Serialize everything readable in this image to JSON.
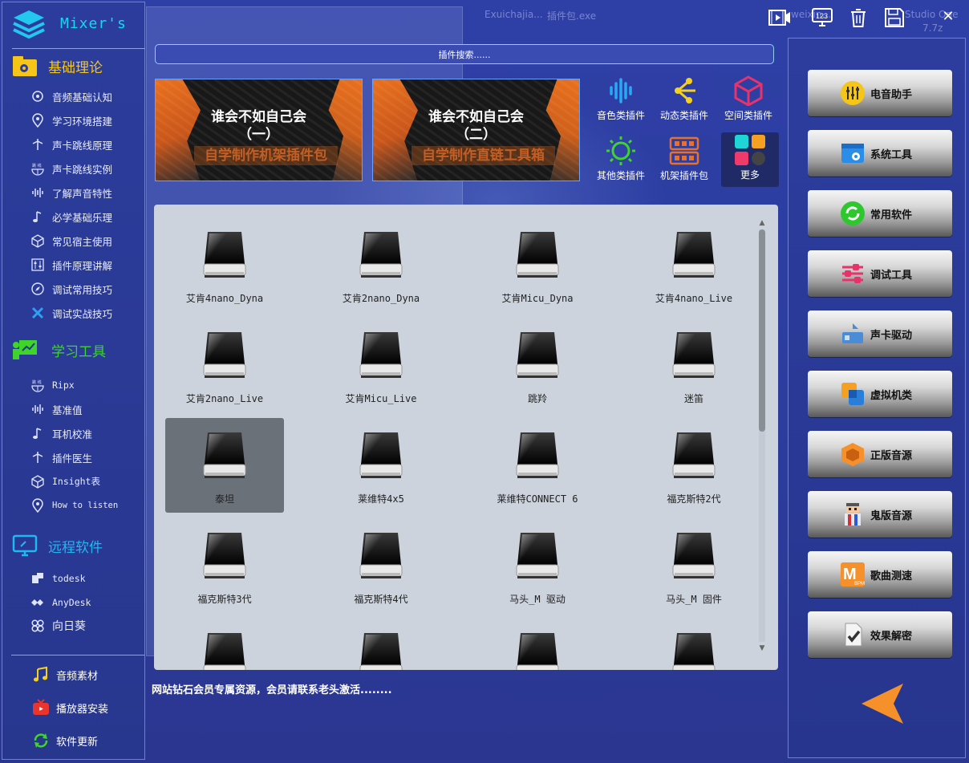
{
  "app": {
    "title": "Mixer's"
  },
  "background_ghost": {
    "file1": "Exuichajia...",
    "file2": "插件包.exe",
    "file3": "weixin...",
    "file4": "Studio One",
    "file5": "7.7z"
  },
  "sidebar": {
    "section1": {
      "title": "基础理论",
      "color": "#f5c518"
    },
    "items1": [
      {
        "label": "音频基础认知",
        "icon": "cloud-gear-icon"
      },
      {
        "label": "学习环境搭建",
        "icon": "pin-icon"
      },
      {
        "label": "声卡跳线原理",
        "icon": "antenna-icon"
      },
      {
        "label": "声卡跳线实例",
        "icon": "jumper-icon"
      },
      {
        "label": "了解声音特性",
        "icon": "waveform-icon"
      },
      {
        "label": "必学基础乐理",
        "icon": "music-note-icon"
      },
      {
        "label": "常见宿主使用",
        "icon": "cube-icon"
      },
      {
        "label": "插件原理讲解",
        "icon": "sliders-icon"
      },
      {
        "label": "调试常用技巧",
        "icon": "compass-icon"
      },
      {
        "label": "调试实战技巧",
        "icon": "cross-tools-icon"
      }
    ],
    "section2": {
      "title": "学习工具",
      "color": "#3fd42a"
    },
    "items2": [
      {
        "label": "Ripx",
        "icon": "jumper-icon"
      },
      {
        "label": "基准值",
        "icon": "waveform-icon"
      },
      {
        "label": "耳机校准",
        "icon": "music-note-icon"
      },
      {
        "label": "插件医生",
        "icon": "antenna-icon"
      },
      {
        "label": "Insight表",
        "icon": "cube-icon"
      },
      {
        "label": "How to listen",
        "icon": "pin-icon"
      }
    ],
    "section3": {
      "title": "远程软件",
      "color": "#20b8f0"
    },
    "items3": [
      {
        "label": "todesk",
        "icon": "todesk-icon"
      },
      {
        "label": "AnyDesk",
        "icon": "anydesk-icon"
      },
      {
        "label": "向日葵",
        "icon": "sunflower-icon"
      }
    ],
    "bottom": [
      {
        "label": "音频素材",
        "icon": "music-notes-icon"
      },
      {
        "label": "播放器安装",
        "icon": "tv-icon"
      },
      {
        "label": "软件更新",
        "icon": "refresh-icon"
      }
    ]
  },
  "search": {
    "placeholder": "插件搜索......"
  },
  "banners": [
    {
      "line1": "谁会不如自己会",
      "line2": "（一）",
      "line3": "自学制作机架插件包"
    },
    {
      "line1": "谁会不如自己会",
      "line2": "（二）",
      "line3": "自学制作直链工具箱"
    }
  ],
  "categories": [
    {
      "label": "音色类插件",
      "icon": "waveform-icon"
    },
    {
      "label": "动态类插件",
      "icon": "nodes-icon"
    },
    {
      "label": "空间类插件",
      "icon": "cube-icon"
    },
    {
      "label": "其他类插件",
      "icon": "sun-icon"
    },
    {
      "label": "机架插件包",
      "icon": "rack-icon"
    },
    {
      "label": "更多",
      "icon": "apps-grid-icon"
    }
  ],
  "plugins": [
    {
      "label": "艾肯4nano_Dyna"
    },
    {
      "label": "艾肯2nano_Dyna"
    },
    {
      "label": "艾肯Micu_Dyna"
    },
    {
      "label": "艾肯4nano_Live"
    },
    {
      "label": "艾肯2nano_Live"
    },
    {
      "label": "艾肯Micu_Live"
    },
    {
      "label": "跳羚"
    },
    {
      "label": "迷笛"
    },
    {
      "label": "泰坦",
      "selected": true
    },
    {
      "label": "莱维特4x5"
    },
    {
      "label": "莱维特CONNECT 6"
    },
    {
      "label": "福克斯特2代"
    },
    {
      "label": "福克斯特3代"
    },
    {
      "label": "福克斯特4代"
    },
    {
      "label": "马头_M 驱动"
    },
    {
      "label": "马头_M 固件"
    },
    {
      "label": ""
    },
    {
      "label": ""
    },
    {
      "label": ""
    },
    {
      "label": ""
    }
  ],
  "notice": "网站钻石会员专属资源，会员请联系老头激活........",
  "right_buttons": [
    {
      "label": "电音助手",
      "icon": "eq-sliders-icon"
    },
    {
      "label": "系统工具",
      "icon": "window-gear-icon"
    },
    {
      "label": "常用软件",
      "icon": "green-circle-icon"
    },
    {
      "label": "调试工具",
      "icon": "pink-sliders-icon"
    },
    {
      "label": "声卡驱动",
      "icon": "sound-card-icon"
    },
    {
      "label": "虚拟机类",
      "icon": "virtual-machine-icon"
    },
    {
      "label": "正版音源",
      "icon": "orange-box-icon"
    },
    {
      "label": "鬼版音源",
      "icon": "character-icon"
    },
    {
      "label": "歌曲测速",
      "icon": "bpm-icon"
    },
    {
      "label": "效果解密",
      "icon": "document-check-icon"
    }
  ],
  "topbar": {
    "icons": [
      "video-icon",
      "123-keypad-icon",
      "trash-icon",
      "save-icon",
      "close-icon"
    ],
    "keypad_text": "123",
    "close_glyph": "✕"
  },
  "colors": {
    "accent": "#20b8f0",
    "bg": "#2c3d9e",
    "grid_bg": "#ccd3dc",
    "arrow": "#f5902a"
  }
}
